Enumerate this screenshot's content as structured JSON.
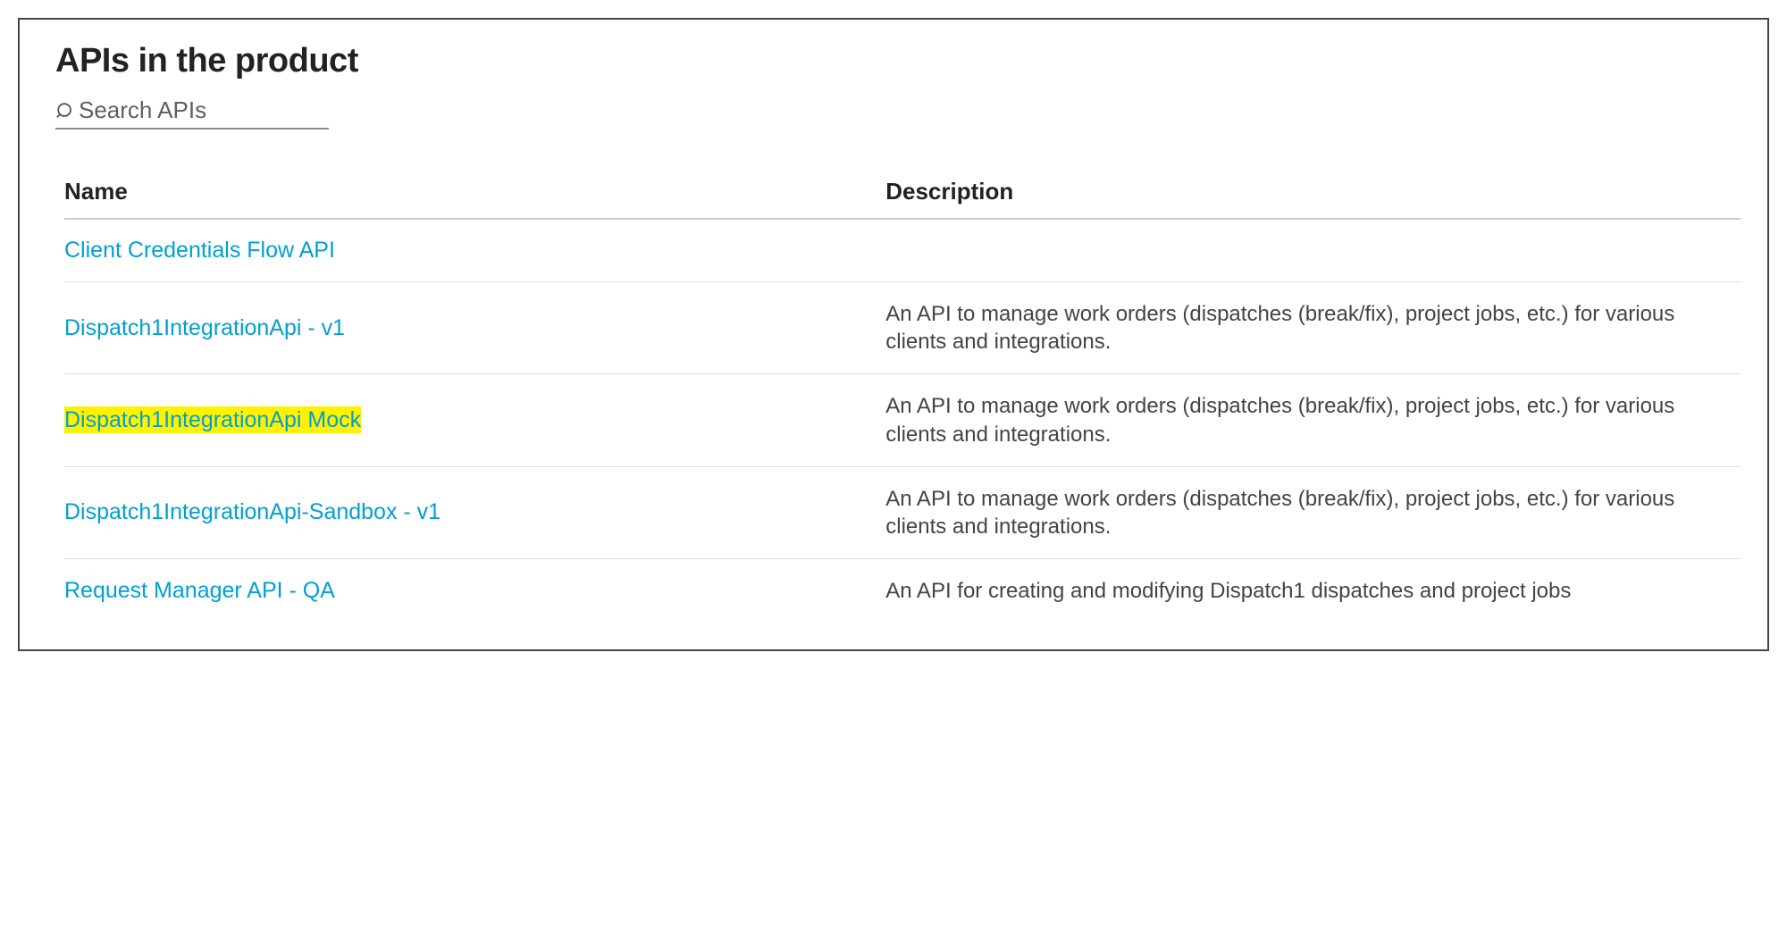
{
  "panel": {
    "title": "APIs in the product",
    "search_placeholder": "Search APIs"
  },
  "table": {
    "headers": {
      "name": "Name",
      "description": "Description"
    },
    "rows": [
      {
        "name": "Client Credentials Flow API",
        "description": "",
        "highlighted": false
      },
      {
        "name": "Dispatch1IntegrationApi - v1",
        "description": "An API to manage work orders (dispatches (break/fix), project jobs, etc.) for various clients and integrations.",
        "highlighted": false
      },
      {
        "name": "Dispatch1IntegrationApi Mock",
        "description": "An API to manage work orders (dispatches (break/fix), project jobs, etc.) for various clients and integrations.",
        "highlighted": true
      },
      {
        "name": "Dispatch1IntegrationApi-Sandbox - v1",
        "description": "An API to manage work orders (dispatches (break/fix), project jobs, etc.) for various clients and integrations.",
        "highlighted": false
      },
      {
        "name": "Request Manager API - QA",
        "description": "An API for creating and modifying Dispatch1 dispatches and project jobs",
        "highlighted": false
      }
    ]
  }
}
